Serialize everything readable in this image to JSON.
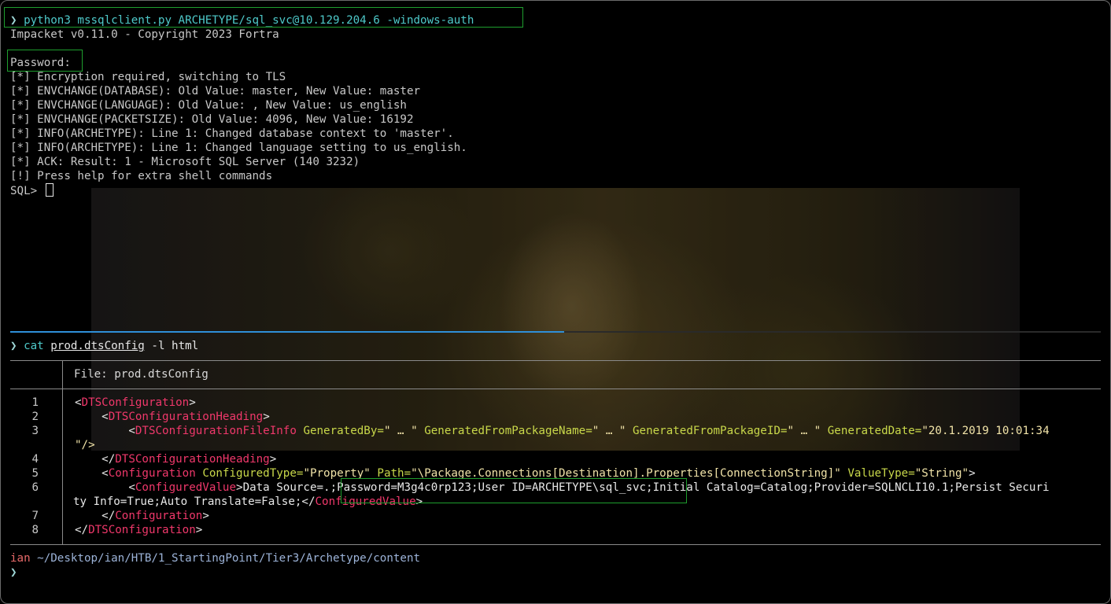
{
  "terminal": {
    "prompt_symbol": "❯",
    "command1": "python3 mssqlclient.py ARCHETYPE/sql_svc@10.129.204.6 -windows-auth",
    "output1": [
      "Impacket v0.11.0 - Copyright 2023 Fortra",
      "",
      "Password:",
      "[*] Encryption required, switching to TLS",
      "[*] ENVCHANGE(DATABASE): Old Value: master, New Value: master",
      "[*] ENVCHANGE(LANGUAGE): Old Value: , New Value: us_english",
      "[*] ENVCHANGE(PACKETSIZE): Old Value: 4096, New Value: 16192",
      "[*] INFO(ARCHETYPE): Line 1: Changed database context to 'master'.",
      "[*] INFO(ARCHETYPE): Line 1: Changed language setting to us_english.",
      "[*] ACK: Result: 1 - Microsoft SQL Server (140 3232)",
      "[!] Press help for extra shell commands"
    ],
    "sql_prompt": "SQL> ",
    "progress_fraction": 0.508,
    "command2_prefix": "cat ",
    "command2_file": "prod.dtsConfig",
    "command2_suffix": " -l html",
    "file_header": "File: prod.dtsConfig",
    "line_numbers": [
      "1",
      "2",
      "3",
      "",
      "4",
      "5",
      "6",
      "",
      "7",
      "8"
    ],
    "code": {
      "l1_open": "<",
      "l1_tag": "DTSConfiguration",
      "l1_close": ">",
      "l2_open": "<",
      "l2_tag": "DTSConfigurationHeading",
      "l2_close": ">",
      "l3_open": "<",
      "l3_tag": "DTSConfigurationFileInfo",
      "l3_a1": "GeneratedBy=",
      "l3_v1": "\" … \"",
      "l3_a2": "GeneratedFromPackageName=",
      "l3_v2": "\" … \"",
      "l3_a3": "GeneratedFromPackageID=",
      "l3_v3": "\" … \"",
      "l3_a4": "GeneratedDate=",
      "l3_v4": "\"20.1.2019 10:01:34",
      "l3b": "\"/>",
      "l4_open": "</",
      "l4_tag": "DTSConfigurationHeading",
      "l4_close": ">",
      "l5_open": "<",
      "l5_tag": "Configuration",
      "l5_a1": "ConfiguredType=",
      "l5_v1": "\"Property\"",
      "l5_a2": "Path=",
      "l5_v2": "\"\\Package.Connections[Destination].Properties[ConnectionString]\"",
      "l5_a3": "ValueType=",
      "l5_v3": "\"String\"",
      "l5_close": ">",
      "l6_open": "<",
      "l6_tag": "ConfiguredValue",
      "l6_mid": ">",
      "l6_text": "Data Source=.;Password=M3g4c0rp123;User ID=ARCHETYPE\\sql_svc;Initial Catalog=Catalog;Provider=SQLNCLI10.1;Persist Securi",
      "l6b_text": "ty Info=True;Auto Translate=False;",
      "l6b_open": "</",
      "l6b_tag": "ConfiguredValue",
      "l6b_close": ">",
      "l7_open": "</",
      "l7_tag": "Configuration",
      "l7_close": ">",
      "l8_open": "</",
      "l8_tag": "DTSConfiguration",
      "l8_close": ">"
    },
    "final_user": "ian",
    "final_path": " ~/Desktop/ian/HTB/1_StartingPoint/Tier3/Archetype/content",
    "colors": {
      "tag": "#f0386b",
      "attr": "#c9d84a",
      "value": "#f1e3a8",
      "highlight_box": "#1e9e2e",
      "progress": "#2f8fd8"
    }
  }
}
